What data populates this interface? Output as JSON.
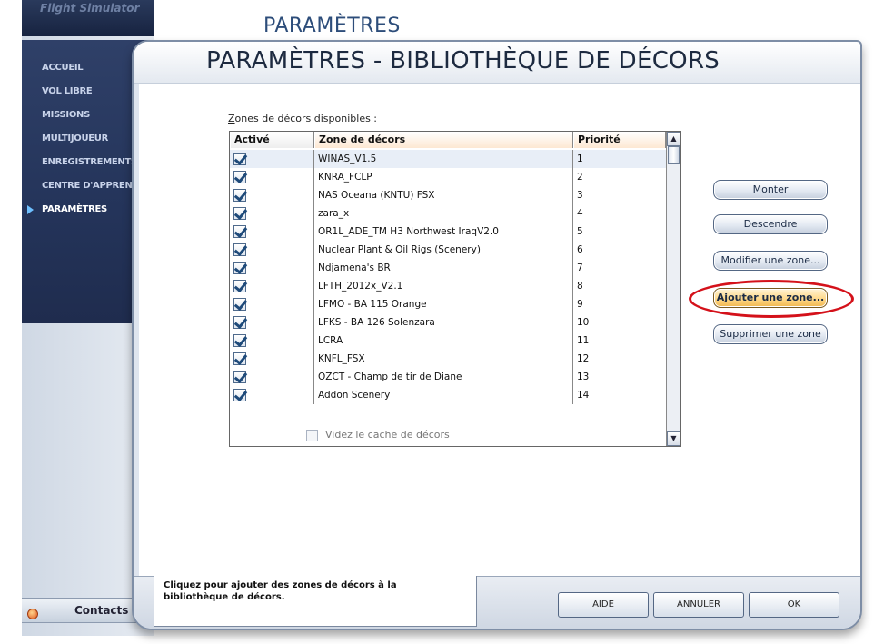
{
  "background_title": "PARAMÈTRES",
  "sidebar": {
    "logo": "Flight Simulator",
    "items": [
      {
        "label": "ACCUEIL"
      },
      {
        "label": "VOL LIBRE"
      },
      {
        "label": "MISSIONS"
      },
      {
        "label": "MULTIJOUEUR"
      },
      {
        "label": "ENREGISTREMENTS"
      },
      {
        "label": "CENTRE D'APPRENTISSAGE"
      },
      {
        "label": "PARAMÈTRES",
        "active": true
      }
    ],
    "contacts_label": "Contacts"
  },
  "dialog": {
    "title": "PARAMÈTRES - BIBLIOTHÈQUE DE DÉCORS",
    "list_label_mnemonic": "Z",
    "list_label_rest": "ones de décors disponibles :",
    "columns": {
      "active": "Activé",
      "zone": "Zone de décors",
      "priority": "Priorité"
    },
    "rows": [
      {
        "zone": "WINAS_V1.5",
        "priority": "1",
        "active": true
      },
      {
        "zone": "KNRA_FCLP",
        "priority": "2",
        "active": true
      },
      {
        "zone": "NAS Oceana (KNTU) FSX",
        "priority": "3",
        "active": true
      },
      {
        "zone": "zara_x",
        "priority": "4",
        "active": true
      },
      {
        "zone": "OR1L_ADE_TM H3 Northwest IraqV2.0",
        "priority": "5",
        "active": true
      },
      {
        "zone": "Nuclear Plant & Oil Rigs (Scenery)",
        "priority": "6",
        "active": true
      },
      {
        "zone": "Ndjamena's BR",
        "priority": "7",
        "active": true
      },
      {
        "zone": "LFTH_2012x_V2.1",
        "priority": "8",
        "active": true
      },
      {
        "zone": "LFMO - BA 115 Orange",
        "priority": "9",
        "active": true
      },
      {
        "zone": "LFKS - BA 126 Solenzara",
        "priority": "10",
        "active": true
      },
      {
        "zone": "LCRA",
        "priority": "11",
        "active": true
      },
      {
        "zone": "KNFL_FSX",
        "priority": "12",
        "active": true
      },
      {
        "zone": "OZCT - Champ de tir de Diane",
        "priority": "13",
        "active": true
      },
      {
        "zone": "Addon Scenery",
        "priority": "14",
        "active": true
      }
    ],
    "cache_label": "Videz le cache de décors",
    "buttons": {
      "move_up": "Monter",
      "move_down": "Descendre",
      "edit_zone": "Modifier une zone...",
      "add_zone": "Ajouter une zone...",
      "delete_zone": "Supprimer une zone"
    },
    "hint": "Cliquez pour ajouter des zones de décors à la bibliothèque de décors.",
    "footer_buttons": {
      "help": "AIDE",
      "cancel": "ANNULER",
      "ok": "OK"
    }
  },
  "highlight_color": "#d4111a"
}
